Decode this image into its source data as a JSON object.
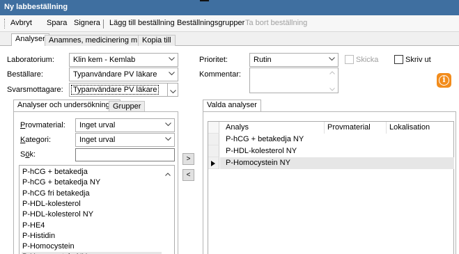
{
  "window": {
    "title": "Ny labbeställning"
  },
  "toolbar": {
    "cancel": "Avbryt",
    "save": "Spara",
    "sign": "Signera",
    "add_order": "Lägg till beställning",
    "order_groups": "Beställningsgrupper",
    "delete_order": "Ta bort beställning"
  },
  "tabs": [
    "Analyser",
    "Anamnes, medicinering m.m.",
    "Kopia till"
  ],
  "form": {
    "laboratory_label": "Laboratorium:",
    "laboratory_value": "Klin kem - Kemlab",
    "orderer_label": "Beställare:",
    "orderer_value": "Typanvändare PV läkare",
    "recipient_label": "Svarsmottagare:",
    "recipient_value": "Typanvändare PV läkare",
    "priority_label": "Prioritet:",
    "priority_value": "Rutin",
    "send_label": "Skicka",
    "print_label": "Skriv ut",
    "comment_label": "Kommentar:"
  },
  "left": {
    "tabs": [
      "Analyser och undersökningar",
      "Grupper"
    ],
    "sample_label": "Provmaterial:",
    "sample_value": "Inget urval",
    "category_label": "Kategori:",
    "category_value": "Inget urval",
    "search_label": "Sök:",
    "search_value": "",
    "items": [
      "P-hCG + betakedja",
      "P-hCG + betakedja NY",
      "P-hCG fri betakedja",
      "P-HDL-kolesterol",
      "P-HDL-kolesterol NY",
      "P-HE4",
      "P-Histidin",
      "P-Homocystein",
      "P-Homocystein NY"
    ],
    "selected_index": 8
  },
  "buttons": {
    "add": ">",
    "remove": "<"
  },
  "right": {
    "tab": "Valda analyser",
    "columns": [
      "Analys",
      "Provmaterial",
      "Lokalisation"
    ],
    "rows": [
      "P-hCG + betakedja NY",
      "P-HDL-kolesterol NY",
      "P-Homocystein NY"
    ],
    "current_row": 2
  },
  "colors": {
    "titlebar": "#3f6fa0",
    "info": "#f28c1c",
    "selection": "#e6e6e6"
  },
  "icons": {
    "info": "info-icon",
    "dropdown": "chevron-down-icon",
    "row_pointer": "row-pointer-icon"
  }
}
